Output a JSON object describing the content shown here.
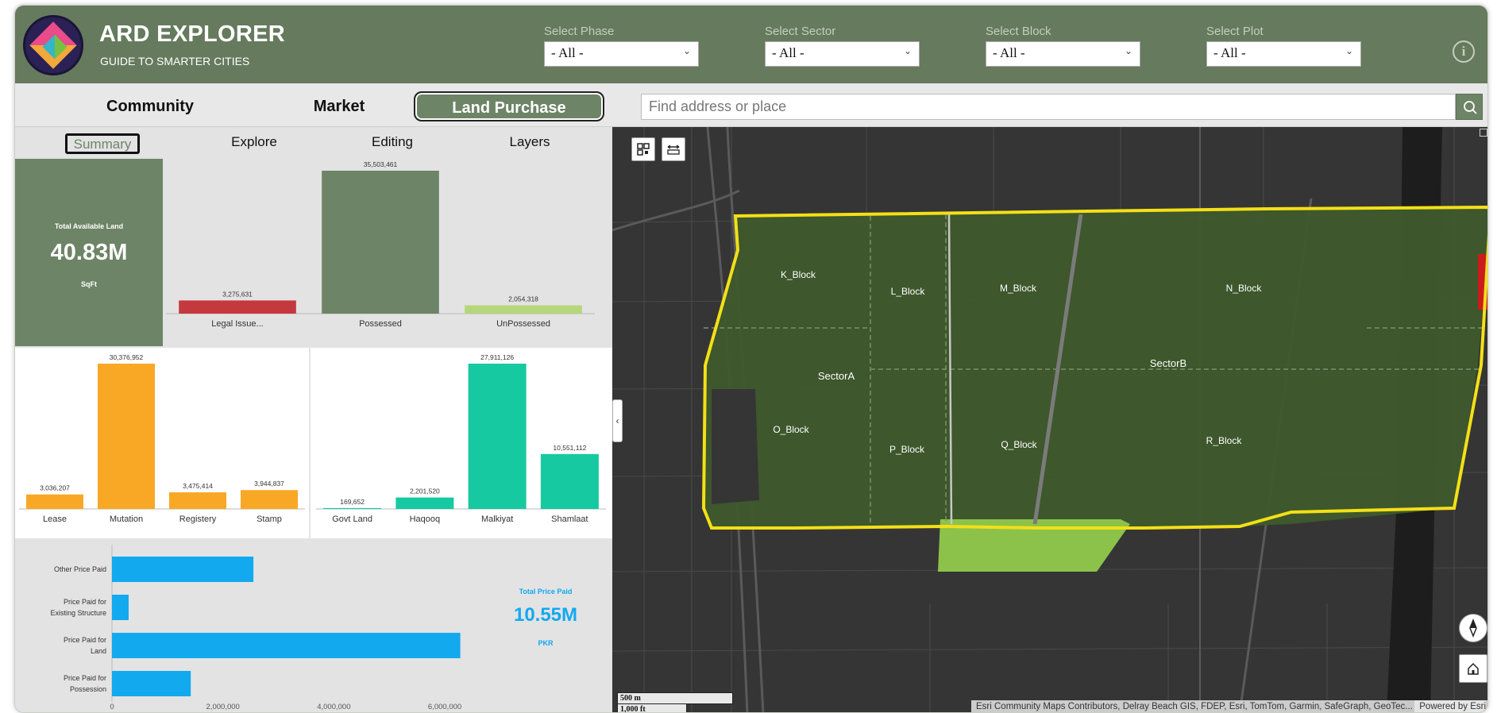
{
  "header": {
    "title": "ARD EXPLORER",
    "subtitle": "GUIDE TO SMARTER CITIES",
    "filters": [
      {
        "label": "Select Phase",
        "value": "- All -"
      },
      {
        "label": "Select Sector",
        "value": "- All -"
      },
      {
        "label": "Select Block",
        "value": "- All -"
      },
      {
        "label": "Select Plot",
        "value": "- All -"
      }
    ],
    "info_icon": "i"
  },
  "nav": {
    "tabs": [
      "Community",
      "Market",
      "Land Purchase"
    ],
    "active_tab": "Land Purchase",
    "search_placeholder": "Find address or place"
  },
  "subtabs": [
    "Summary",
    "Explore",
    "Editing",
    "Layers"
  ],
  "active_subtab": "Summary",
  "total_available_land": {
    "title": "Total Available Land",
    "value": "40.83M",
    "unit": "SqFt"
  },
  "total_price_paid": {
    "title": "Total Price Paid",
    "value": "10.55M",
    "unit": "PKR"
  },
  "chart_data": [
    {
      "type": "bar",
      "categories": [
        "Legal Issue...",
        "Possessed",
        "UnPossessed"
      ],
      "values": [
        3275631,
        35503461,
        2054318
      ],
      "labels": [
        "3,275,631",
        "35,503,461",
        "2,054,318"
      ],
      "colors": [
        "#c4393d",
        "#6d8466",
        "#b5d67a"
      ],
      "ylim": [
        0,
        35503461
      ]
    },
    {
      "type": "bar",
      "categories": [
        "Lease",
        "Mutation",
        "Registery",
        "Stamp"
      ],
      "values": [
        3036207,
        30376952,
        3475414,
        3944837
      ],
      "labels": [
        "3,036,207",
        "30,376,952",
        "3,475,414",
        "3,944,837"
      ],
      "colors": [
        "#f9a825",
        "#f9a825",
        "#f9a825",
        "#f9a825"
      ],
      "ylim": [
        0,
        30376952
      ]
    },
    {
      "type": "bar",
      "categories": [
        "Govt Land",
        "Haqooq",
        "Malkiyat",
        "Shamlaat"
      ],
      "values": [
        169652,
        2201520,
        27911126,
        10551112
      ],
      "labels": [
        "169,652",
        "2,201,520",
        "27,911,126",
        "10,551,112"
      ],
      "colors": [
        "#17c9a1",
        "#17c9a1",
        "#17c9a1",
        "#17c9a1"
      ],
      "ylim": [
        0,
        27911126
      ]
    },
    {
      "type": "bar",
      "orientation": "horizontal",
      "categories": [
        "Other Price Paid",
        "Price Paid for Existing Structure",
        "Price Paid for Land",
        "Price Paid for Possession"
      ],
      "category_lines": [
        [
          "Other Price Paid"
        ],
        [
          "Price Paid for",
          "Existing Structure"
        ],
        [
          "Price Paid for",
          "Land"
        ],
        [
          "Price Paid for",
          "Possession"
        ]
      ],
      "values": [
        2550000,
        300000,
        6280000,
        1420000
      ],
      "color": "#12a9ef",
      "xlim": [
        0,
        6300000
      ],
      "xticks": [
        0,
        2000000,
        4000000,
        6000000
      ],
      "xtick_labels": [
        "0",
        "2,000,000",
        "4,000,000",
        "6,000,000"
      ]
    }
  ],
  "map": {
    "labels": {
      "blocks": [
        "K_Block",
        "L_Block",
        "M_Block",
        "N_Block",
        "O_Block",
        "P_Block",
        "Q_Block",
        "R_Block"
      ],
      "sectors": [
        "SectorA",
        "SectorB"
      ]
    },
    "scale": [
      "500 m",
      "1,000 ft"
    ],
    "attribution": "Esri Community Maps Contributors, Delray Beach GIS, FDEP, Esri, TomTom, Garmin, SafeGraph, GeoTec...",
    "powered_by": "Powered by Esri",
    "colors": {
      "boundary": "#f3e017",
      "parcel_fill": "#3f5a2c",
      "highlight": "#8cc24a",
      "issue": "#cc1b1b"
    }
  }
}
